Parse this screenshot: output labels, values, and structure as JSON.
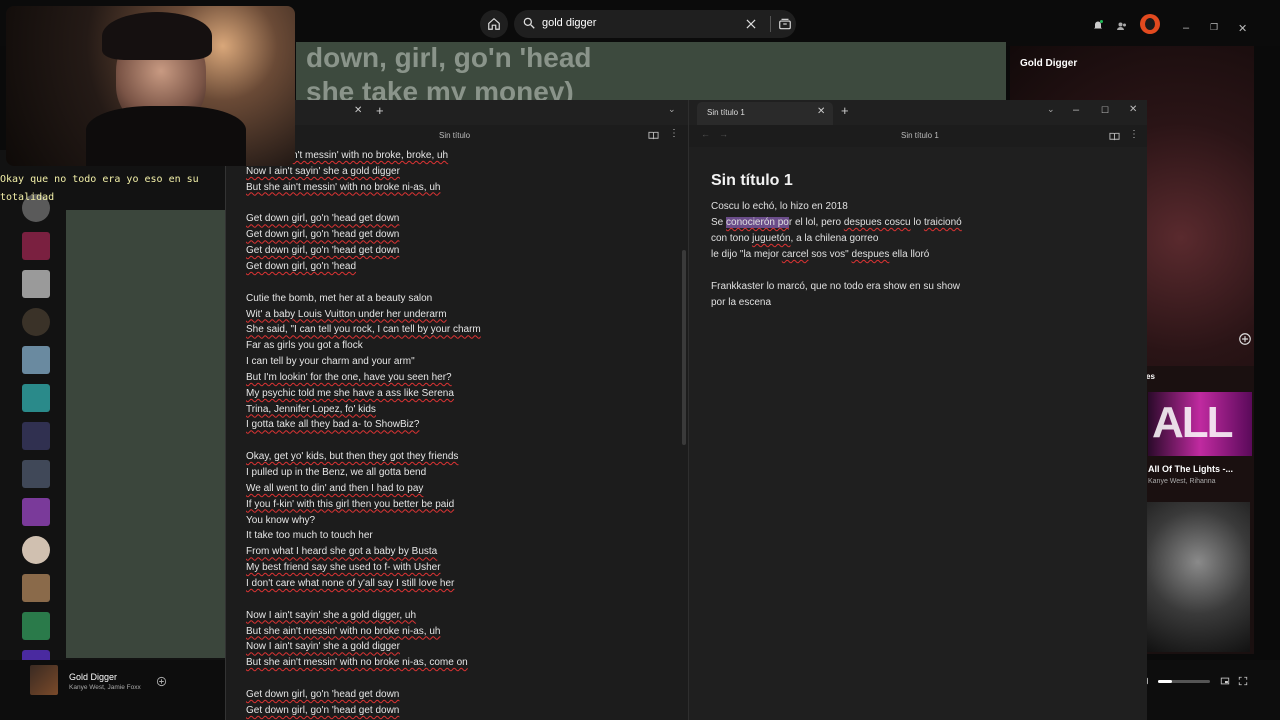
{
  "spotify": {
    "search": {
      "value": "gold digger"
    },
    "lyrics_bg": [
      "down, girl, go'n 'head",
      "she take my money)"
    ],
    "right_panel": {
      "title": "Gold Digger",
      "up_next_label": "es",
      "next_song": "All Of The Lights -...",
      "next_artist": "Kanye West, Rihanna"
    },
    "now_playing": {
      "title": "Gold Digger",
      "artist": "Kanye West, Jamie Foxx"
    },
    "library_thumb_colors": [
      "#5a5a5a",
      "#7a2040",
      "#9a9a9a",
      "#3a3228",
      "#6a8aa0",
      "#2a8a8a",
      "#303050",
      "#404858",
      "#7a3a9a",
      "#d0c0b0",
      "#8a6a4a",
      "#2a7a4a",
      "#4a2aa0"
    ]
  },
  "caption": "Okay que no todo era yo eso en su totalidad",
  "notepad_left": {
    "doc_title": "Sin título",
    "lines": [
      {
        "text": "n't messin' with no broke, broke, uh",
        "u": true
      },
      {
        "text": "Now I ain't sayin' she a gold digger",
        "u": true
      },
      {
        "text": "But she ain't messin' with no broke ni-as, uh",
        "u": true
      },
      {
        "text": "",
        "u": false
      },
      {
        "text": "Get down girl, go'n 'head get down",
        "u": true
      },
      {
        "text": "Get down girl, go'n 'head get down",
        "u": true
      },
      {
        "text": "Get down girl, go'n 'head get down",
        "u": true
      },
      {
        "text": "Get down girl, go'n 'head",
        "u": true
      },
      {
        "text": "",
        "u": false
      },
      {
        "text": "Cutie the bomb, met her at a beauty salon",
        "u": false
      },
      {
        "text": "Wit' a baby Louis Vuitton under her underarm",
        "u": true
      },
      {
        "text": "She said, \"I can tell you rock, I can tell by your charm",
        "u": true
      },
      {
        "text": "Far as girls you got a flock",
        "u": false
      },
      {
        "text": "I can tell by your charm and your arm\"",
        "u": false
      },
      {
        "text": "But I'm lookin' for the one, have you seen her?",
        "u": true
      },
      {
        "text": "My psychic told me she have a ass like Serena",
        "u": true
      },
      {
        "text": "Trina, Jennifer Lopez, fo' kids",
        "u": true
      },
      {
        "text": "I gotta take all they bad a- to ShowBiz?",
        "u": true
      },
      {
        "text": "",
        "u": false
      },
      {
        "text": "Okay, get yo' kids, but then they got they friends",
        "u": true
      },
      {
        "text": "I pulled up in the Benz, we all gotta bend",
        "u": false
      },
      {
        "text": "We all went to din' and then I had to pay",
        "u": true
      },
      {
        "text": "If you f-kin' with this girl then you better be paid",
        "u": true
      },
      {
        "text": "You know why?",
        "u": false
      },
      {
        "text": "It take too much to touch her",
        "u": false
      },
      {
        "text": "From what I heard she got a baby by Busta",
        "u": true
      },
      {
        "text": "My best friend say she used to f- with Usher",
        "u": true
      },
      {
        "text": "I don't care what none of y'all say I still love her",
        "u": true
      },
      {
        "text": "",
        "u": false
      },
      {
        "text": "Now I ain't sayin' she a gold digger, uh",
        "u": true
      },
      {
        "text": "But she ain't messin' with no broke ni-as, uh",
        "u": true
      },
      {
        "text": "Now I ain't sayin' she a gold digger",
        "u": true
      },
      {
        "text": "But she ain't messin' with no broke ni-as, come on",
        "u": true
      },
      {
        "text": "",
        "u": false
      },
      {
        "text": "Get down girl, go'n 'head get down",
        "u": true
      },
      {
        "text": "Get down girl, go'n 'head get down",
        "u": true
      }
    ]
  },
  "notepad_right": {
    "tab_label": "Sin título 1",
    "doc_title": "Sin título 1",
    "heading": "Sin título 1",
    "l1": "Coscu lo echó, lo hizo en 2018",
    "l2_a": "Se ",
    "l2_hl": "conocierón po",
    "l2_b": "r el lol, pero ",
    "l2_c": "despues coscu",
    "l2_d": " lo ",
    "l2_e": "traicionó",
    "l3_a": "con tono ",
    "l3_b": "juguetón",
    "l3_c": ", a la ",
    "l3_d": "chilena gorreo",
    "l4_a": "le dijo \"la mejor ",
    "l4_b": "carcel",
    "l4_c": " sos vos\" ",
    "l4_d": "despues",
    "l4_e": " ella lloró",
    "l5": "Frankkaster lo marcó, que no todo era show en su show",
    "l6": "por la escena"
  }
}
